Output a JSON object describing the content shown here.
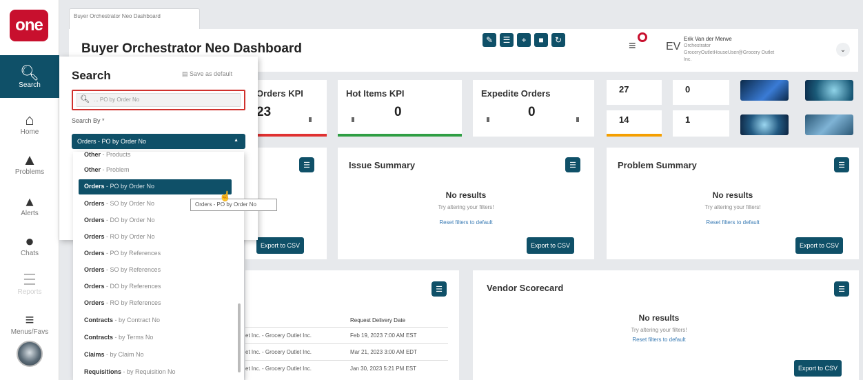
{
  "app": {
    "logo": "one"
  },
  "nav": {
    "items": [
      {
        "label": "Search",
        "icon": "search-icon"
      },
      {
        "label": "Home",
        "icon": "home-icon"
      },
      {
        "label": "Problems",
        "icon": "warning-icon"
      },
      {
        "label": "Alerts",
        "icon": "bell-icon"
      },
      {
        "label": "Chats",
        "icon": "chat-icon"
      },
      {
        "label": "Reports",
        "icon": "reports-icon"
      },
      {
        "label": "Menus/Favs",
        "icon": "menu-icon"
      }
    ]
  },
  "tab": {
    "label": "Buyer Orchestrator Neo Dashboard"
  },
  "header": {
    "title": "Buyer Orchestrator Neo Dashboard",
    "tools": [
      "edit-icon",
      "list-icon",
      "plus-icon",
      "copy-icon",
      "refresh-icon"
    ],
    "user": {
      "initials": "EV",
      "name": "Erik Van der Merwe",
      "role": "Orchestrator",
      "email": "GroceryOutletHouseUser@Grocery Outlet Inc."
    }
  },
  "kpis": [
    {
      "title": "Orders KPI",
      "value": "23",
      "bar_color": "#e03131"
    },
    {
      "title": "Hot Items KPI",
      "value": "0",
      "bar_color": "#2f9e44"
    },
    {
      "title": "Expedite Orders",
      "value": "0",
      "bar_color": ""
    }
  ],
  "mini_tiles": [
    "27",
    "0",
    "14",
    "1"
  ],
  "mini_bar_color": "#f59f00",
  "cards": {
    "issue": {
      "title": "Issue Summary",
      "no_results": "No results",
      "hint": "Try altering your filters!",
      "reset": "Reset filters to default",
      "export": "Export to CSV"
    },
    "problem": {
      "title": "Problem Summary",
      "no_results": "No results",
      "hint": "Try altering your filters!",
      "reset": "Reset filters to default",
      "export": "Export to CSV"
    },
    "vendor": {
      "title": "Vendor Scorecard",
      "no_results": "No results",
      "hint": "Try altering your filters!",
      "reset": "Reset filters to default",
      "export": "Export to CSV"
    },
    "left": {
      "export": "Export to CSV"
    }
  },
  "table": {
    "header": "Request Delivery Date",
    "rows": [
      {
        "party": "et Inc. - Grocery Outlet Inc.",
        "date": "Feb 19, 2023 7:00 AM EST"
      },
      {
        "party": "et Inc. - Grocery Outlet Inc.",
        "date": "Mar 21, 2023 3:00 AM EDT"
      },
      {
        "party": "et Inc. - Grocery Outlet Inc.",
        "date": "Jan 30, 2023 5:21 PM EST"
      }
    ]
  },
  "search": {
    "title": "Search",
    "save_default": "Save as default",
    "placeholder": "... PO by Order No",
    "search_by_label": "Search By *",
    "selected": "Orders - PO by Order No",
    "options": [
      {
        "cat": "Other",
        "desc": "- Products"
      },
      {
        "cat": "Other",
        "desc": "- Problem"
      },
      {
        "cat": "Orders",
        "desc": "- PO by Order No",
        "selected": true
      },
      {
        "cat": "Orders",
        "desc": "- SO by Order No"
      },
      {
        "cat": "Orders",
        "desc": "- DO by Order No"
      },
      {
        "cat": "Orders",
        "desc": "- RO by Order No"
      },
      {
        "cat": "Orders",
        "desc": "- PO by References"
      },
      {
        "cat": "Orders",
        "desc": "- SO by References"
      },
      {
        "cat": "Orders",
        "desc": "- DO by References"
      },
      {
        "cat": "Orders",
        "desc": "- RO by References"
      },
      {
        "cat": "Contracts",
        "desc": "- by Contract No"
      },
      {
        "cat": "Contracts",
        "desc": "- by Terms No"
      },
      {
        "cat": "Claims",
        "desc": "- by Claim No"
      },
      {
        "cat": "Requisitions",
        "desc": "- by Requisition No"
      }
    ],
    "tooltip": "Orders - PO by Order No"
  }
}
